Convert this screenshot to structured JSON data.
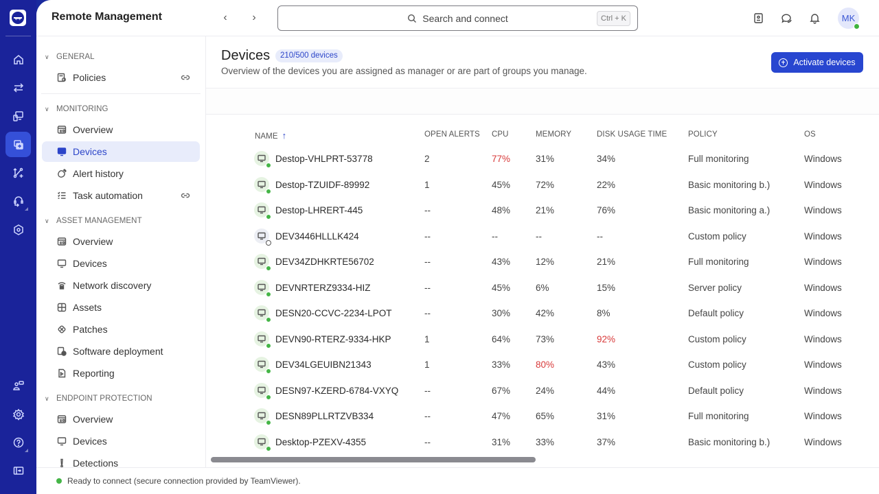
{
  "app": {
    "title": "Remote Management",
    "brand_color": "#1a239a",
    "accent_color": "#2846d0"
  },
  "rail": {
    "items": [
      {
        "icon": "home-icon"
      },
      {
        "icon": "transfer-icon"
      },
      {
        "icon": "devices-icon"
      },
      {
        "icon": "remote-management-icon",
        "active": true
      },
      {
        "icon": "workflow-icon"
      },
      {
        "icon": "support-headset-icon"
      },
      {
        "icon": "security-icon"
      }
    ],
    "bottom_items": [
      {
        "icon": "community-icon"
      },
      {
        "icon": "settings-icon"
      },
      {
        "icon": "help-icon"
      },
      {
        "icon": "collapse-panel-icon"
      }
    ]
  },
  "topbar": {
    "back_icon": "chevron-left-icon",
    "forward_icon": "chevron-right-icon",
    "search_placeholder": "Search and connect",
    "search_shortcut": "Ctrl + K",
    "icons": [
      "contacts-icon",
      "chat-icon",
      "notifications-icon"
    ],
    "avatar_initials": "MK",
    "avatar_status": "online"
  },
  "sidebar": {
    "sections": [
      {
        "title": "GENERAL",
        "items": [
          {
            "label": "Policies",
            "icon": "policy-icon",
            "link": true
          }
        ]
      },
      {
        "title": "MONITORING",
        "items": [
          {
            "label": "Overview",
            "icon": "dashboard-icon"
          },
          {
            "label": "Devices",
            "icon": "monitor-icon",
            "active": true
          },
          {
            "label": "Alert history",
            "icon": "alert-history-icon"
          },
          {
            "label": "Task automation",
            "icon": "task-list-icon",
            "link": true
          }
        ]
      },
      {
        "title": "ASSET MANAGEMENT",
        "items": [
          {
            "label": "Overview",
            "icon": "dashboard-icon"
          },
          {
            "label": "Devices",
            "icon": "monitor-icon"
          },
          {
            "label": "Network discovery",
            "icon": "network-discovery-icon"
          },
          {
            "label": "Assets",
            "icon": "assets-grid-icon"
          },
          {
            "label": "Patches",
            "icon": "patch-icon"
          },
          {
            "label": "Software deployment",
            "icon": "software-deployment-icon"
          },
          {
            "label": "Reporting",
            "icon": "report-icon"
          }
        ]
      },
      {
        "title": "ENDPOINT PROTECTION",
        "items": [
          {
            "label": "Overview",
            "icon": "dashboard-icon"
          },
          {
            "label": "Devices",
            "icon": "monitor-icon"
          },
          {
            "label": "Detections",
            "icon": "exclamation-icon"
          }
        ]
      }
    ]
  },
  "page": {
    "title": "Devices",
    "count_badge": "210/500 devices",
    "subtitle": "Overview of the devices you are assigned as manager or are part of groups you manage.",
    "primary_button": "Activate devices"
  },
  "table": {
    "columns": [
      "NAME",
      "OPEN ALERTS",
      "CPU",
      "MEMORY",
      "DISK USAGE TIME",
      "POLICY",
      "OS"
    ],
    "sort": {
      "column": "NAME",
      "direction": "ascending"
    },
    "alert_color": "#d83a3a",
    "rows": [
      {
        "name": "Destop-VHLPRT-53778",
        "online": true,
        "alerts": "2",
        "cpu": "77%",
        "memory": "31%",
        "disk": "34%",
        "policy": "Full monitoring",
        "os": "Windows",
        "cpu_alert": true
      },
      {
        "name": "Destop-TZUIDF-89992",
        "online": true,
        "alerts": "1",
        "cpu": "45%",
        "memory": "72%",
        "disk": "22%",
        "policy": "Basic monitoring b.)",
        "os": "Windows"
      },
      {
        "name": "Destop-LHRERT-445",
        "online": true,
        "alerts": "--",
        "cpu": "48%",
        "memory": "21%",
        "disk": "76%",
        "policy": "Basic monitoring a.)",
        "os": "Windows"
      },
      {
        "name": "DEV3446HLLLK424",
        "online": false,
        "alerts": "--",
        "cpu": "--",
        "memory": "--",
        "disk": "--",
        "policy": "Custom policy",
        "os": "Windows"
      },
      {
        "name": "DEV34ZDHKRTE56702",
        "online": true,
        "alerts": "--",
        "cpu": "43%",
        "memory": "12%",
        "disk": "21%",
        "policy": "Full monitoring",
        "os": "Windows"
      },
      {
        "name": "DEVNRTERZ9334-HIZ",
        "online": true,
        "alerts": "--",
        "cpu": "45%",
        "memory": "6%",
        "disk": "15%",
        "policy": "Server policy",
        "os": "Windows"
      },
      {
        "name": "DESN20-CCVC-2234-LPOT",
        "online": true,
        "alerts": "--",
        "cpu": "30%",
        "memory": "42%",
        "disk": "8%",
        "policy": "Default policy",
        "os": "Windows"
      },
      {
        "name": "DEVN90-RTERZ-9334-HKP",
        "online": true,
        "alerts": "1",
        "cpu": "64%",
        "memory": "73%",
        "disk": "92%",
        "policy": "Custom policy",
        "os": "Windows",
        "disk_alert": true
      },
      {
        "name": "DEV34LGEUIBN21343",
        "online": true,
        "alerts": "1",
        "cpu": "33%",
        "memory": "80%",
        "disk": "43%",
        "policy": "Custom policy",
        "os": "Windows",
        "memory_alert": true
      },
      {
        "name": "DESN97-KZERD-6784-VXYQ",
        "online": true,
        "alerts": "--",
        "cpu": "67%",
        "memory": "24%",
        "disk": "44%",
        "policy": "Default policy",
        "os": "Windows"
      },
      {
        "name": "DESN89PLLRTZVB334",
        "online": true,
        "alerts": "--",
        "cpu": "47%",
        "memory": "65%",
        "disk": "31%",
        "policy": "Full monitoring",
        "os": "Windows"
      },
      {
        "name": "Desktop-PZEXV-4355",
        "online": true,
        "alerts": "--",
        "cpu": "31%",
        "memory": "33%",
        "disk": "37%",
        "policy": "Basic monitoring b.)",
        "os": "Windows"
      }
    ]
  },
  "status_bar": {
    "text": "Ready to connect (secure connection provided by TeamViewer).",
    "status": "ready"
  }
}
